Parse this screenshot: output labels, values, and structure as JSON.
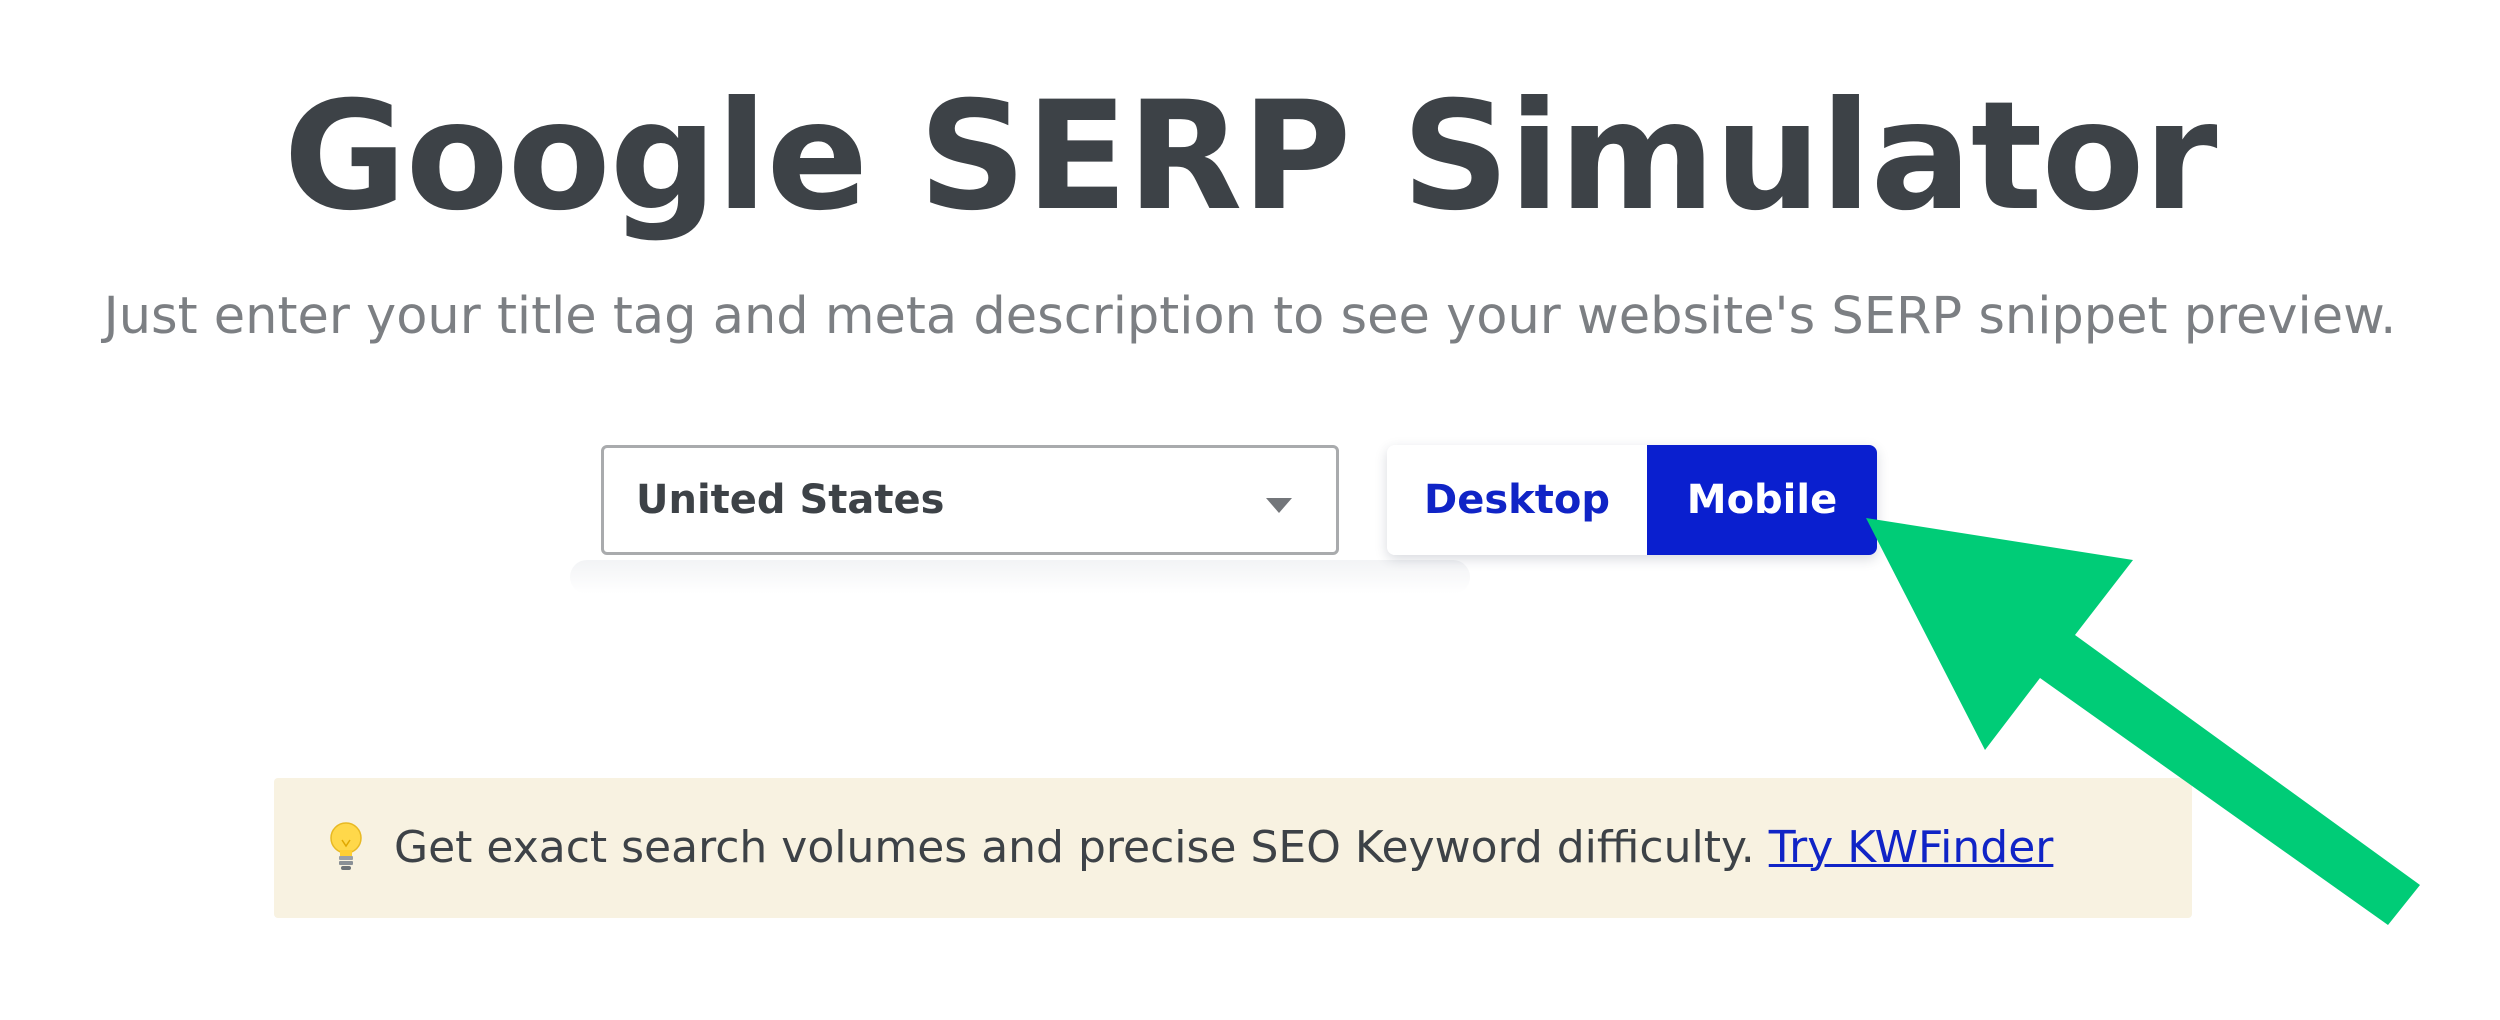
{
  "header": {
    "title": "Google SERP Simulator",
    "subtitle": "Just enter your title tag and meta description to see your website's SERP snippet preview."
  },
  "controls": {
    "country_select": {
      "selected": "United States",
      "icon": "chevron-down-icon"
    },
    "device_toggle": {
      "desktop_label": "Desktop",
      "mobile_label": "Mobile",
      "active": "Mobile"
    }
  },
  "banner": {
    "icon": "lightbulb-icon",
    "text": "Get exact search volumes and precise SEO Keyword difficulty.",
    "link_label": "Try KWFinder"
  },
  "annotation": {
    "arrow_color": "#00cc77",
    "arrow_target": "Mobile"
  },
  "colors": {
    "accent": "#0a1fcf",
    "title": "#3d4247",
    "subtitle": "#7c7f83",
    "banner_bg": "#f8f2e1"
  }
}
